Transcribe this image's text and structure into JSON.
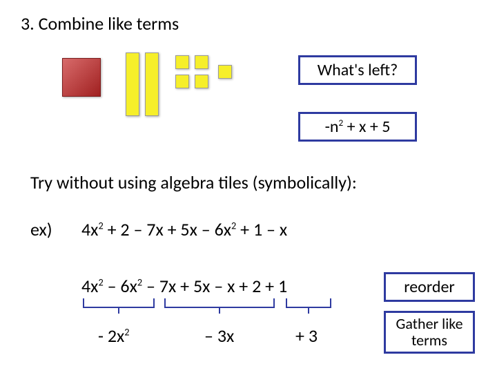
{
  "title": "3. Combine like terms",
  "callouts": {
    "whats_left": "What's left?",
    "reorder": "reorder",
    "gather": "Gather like terms"
  },
  "result_expr": {
    "pre": "-n",
    "sup": "2",
    "post": " + x + 5"
  },
  "try_line": "Try without using algebra tiles (symbolically):",
  "ex_label": "ex)",
  "ex_expr": {
    "parts": [
      {
        "t": "4x",
        "sup": "2"
      },
      {
        "t": " + 2 – 7x + 5x – 6x"
      },
      {
        "sup": "2"
      },
      {
        "t": " + 1 – x"
      }
    ]
  },
  "reorder_expr": {
    "parts": [
      {
        "t": "4x",
        "sup": "2"
      },
      {
        "t": " – 6x",
        "sup": "2"
      },
      {
        "t": " – 7x + 5x – x + 2 + 1"
      }
    ]
  },
  "gathered": {
    "a": {
      "pre": "- 2x",
      "sup": "2"
    },
    "b": "– 3x",
    "c": "+ 3"
  }
}
